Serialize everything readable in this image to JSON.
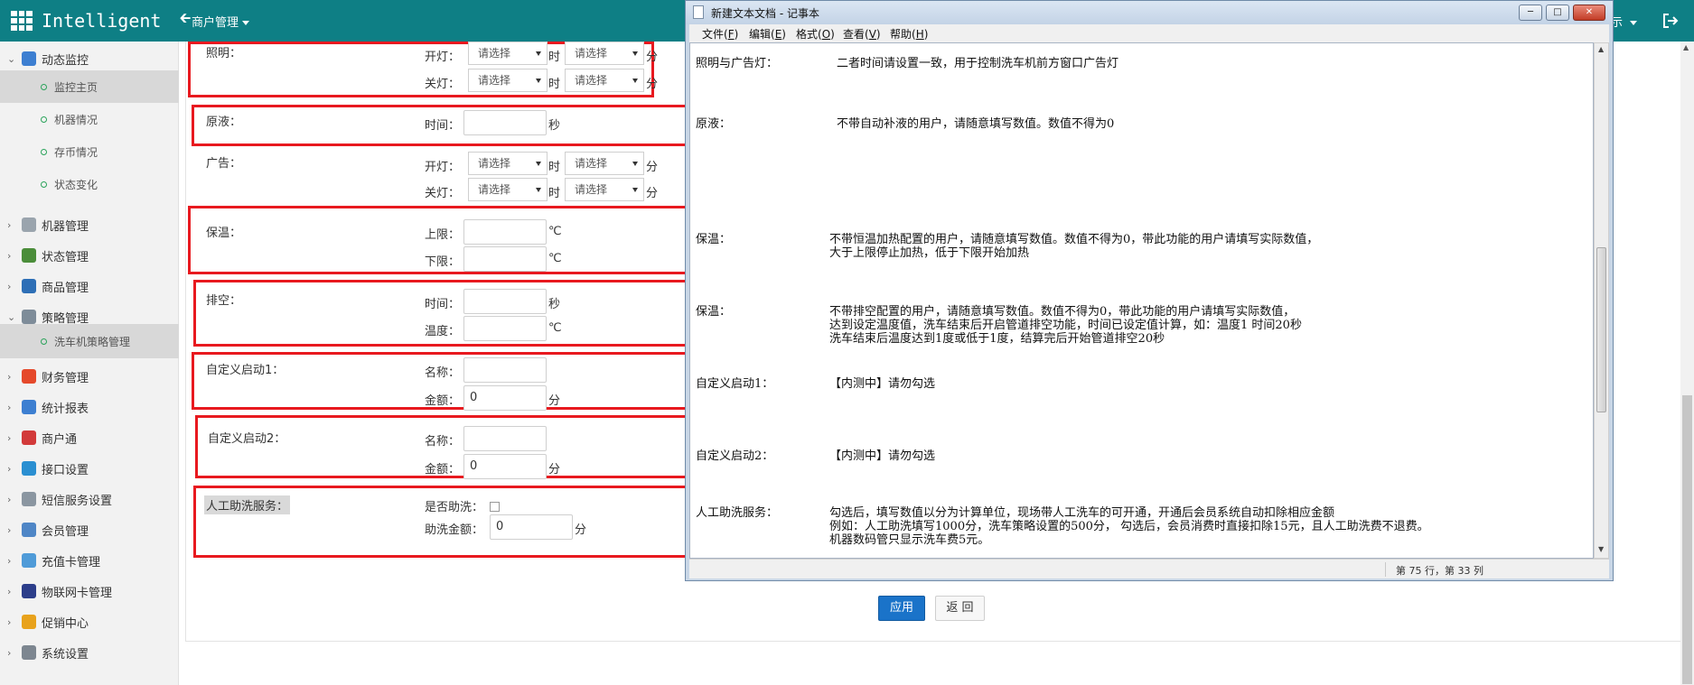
{
  "header": {
    "app_title": "Intelligent",
    "merchant_menu": "商户管理",
    "right_tail_text": "示"
  },
  "sidebar": {
    "groups": [
      {
        "label": "动态监控",
        "icon": "monitor-icon",
        "color": "#3d7fd1",
        "expanded": true
      },
      {
        "label": "机器管理",
        "icon": "machine-icon",
        "color": "#9aa4ad"
      },
      {
        "label": "状态管理",
        "icon": "status-tree-icon",
        "color": "#4b8d3a"
      },
      {
        "label": "商品管理",
        "icon": "goods-icon",
        "color": "#2e6fb6"
      },
      {
        "label": "策略管理",
        "icon": "strategy-icon",
        "color": "#7e8c99",
        "expanded": true
      },
      {
        "label": "财务管理",
        "icon": "finance-icon",
        "color": "#e5492b"
      },
      {
        "label": "统计报表",
        "icon": "report-icon",
        "color": "#3d7fd1"
      },
      {
        "label": "商户通",
        "icon": "merchant-icon",
        "color": "#d23a3a"
      },
      {
        "label": "接口设置",
        "icon": "api-icon",
        "color": "#2a8fd1"
      },
      {
        "label": "短信服务设置",
        "icon": "sms-icon",
        "color": "#8b96a1"
      },
      {
        "label": "会员管理",
        "icon": "member-icon",
        "color": "#4f86c6"
      },
      {
        "label": "充值卡管理",
        "icon": "card-icon",
        "color": "#4f9bd8"
      },
      {
        "label": "物联网卡管理",
        "icon": "iot-icon",
        "color": "#2c3e8a"
      },
      {
        "label": "促销中心",
        "icon": "promo-icon",
        "color": "#e8a21c"
      },
      {
        "label": "系统设置",
        "icon": "settings-icon",
        "color": "#7d8690"
      }
    ],
    "monitor_items": [
      "监控主页",
      "机器情况",
      "存币情况",
      "状态变化"
    ],
    "strategy_items": [
      "洗车机策略管理"
    ]
  },
  "form": {
    "lighting": {
      "label": "照明：",
      "on": "开灯：",
      "off": "关灯："
    },
    "liquid": {
      "label": "原液：",
      "time": "时间："
    },
    "ads": {
      "label": "广告：",
      "on": "开灯：",
      "off": "关灯："
    },
    "keepwarm": {
      "label": "保温：",
      "upper": "上限：",
      "lower": "下限："
    },
    "drain": {
      "label": "排空：",
      "time": "时间：",
      "temp": "温度："
    },
    "custom1": {
      "label": "自定义启动1：",
      "name": "名称：",
      "amount": "金额：",
      "amount_value": "0"
    },
    "custom2": {
      "label": "自定义启动2：",
      "name": "名称：",
      "amount": "金额：",
      "amount_value": "0"
    },
    "manual": {
      "label": "人工助洗服务：",
      "assist_q": "是否助洗：",
      "assist_amount": "助洗金额：",
      "amount_value": "0"
    },
    "units": {
      "hour": "时",
      "minute": "分",
      "second": "秒",
      "celsius": "℃"
    },
    "select_placeholder": "请选择",
    "apply_button": "应用",
    "back_button": "返 回"
  },
  "notepad": {
    "title": "新建文本文档 - 记事本",
    "menu": [
      {
        "name": "文件",
        "key": "F"
      },
      {
        "name": "编辑",
        "key": "E"
      },
      {
        "name": "格式",
        "key": "O"
      },
      {
        "name": "查看",
        "key": "V"
      },
      {
        "name": "帮助",
        "key": "H"
      }
    ],
    "status": "第 75 行，第 33 列",
    "notes": {
      "l1_label": "照明与广告灯：",
      "l1_text": "二者时间请设置一致，用于控制洗车机前方窗口广告灯",
      "l2_label": "原液：",
      "l2_text": "不带自动补液的用户，请随意填写数值。数值不得为0",
      "l3_label": "保温：",
      "l3_text1": "不带恒温加热配置的用户，请随意填写数值。数值不得为0，带此功能的用户请填写实际数值，",
      "l3_text2": "大于上限停止加热，低于下限开始加热",
      "l4_label": "保温：",
      "l4_text1": "不带排空配置的用户，请随意填写数值。数值不得为0，带此功能的用户请填写实际数值，",
      "l4_text2": "达到设定温度值，洗车结束后开启管道排空功能，时间已设定值计算，如：温度1  时间20秒",
      "l4_text3": "洗车结束后温度达到1度或低于1度，结算完后开始管道排空20秒",
      "l5_label": "自定义启动1：",
      "l5_text": "【内测中】请勿勾选",
      "l6_label": "自定义启动2：",
      "l6_text": "【内测中】请勿勾选",
      "l7_label": "人工助洗服务：",
      "l7_text1": "勾选后，填写数值以分为计算单位，现场带人工洗车的可开通，开通后会员系统自动扣除相应金额",
      "l7_text2": "例如：人工助洗填写1000分，洗车策略设置的500分，  勾选后，会员消费时直接扣除15元，且人工助洗费不退费。",
      "l7_text3": "机器数码管只显示洗车费5元。"
    }
  }
}
